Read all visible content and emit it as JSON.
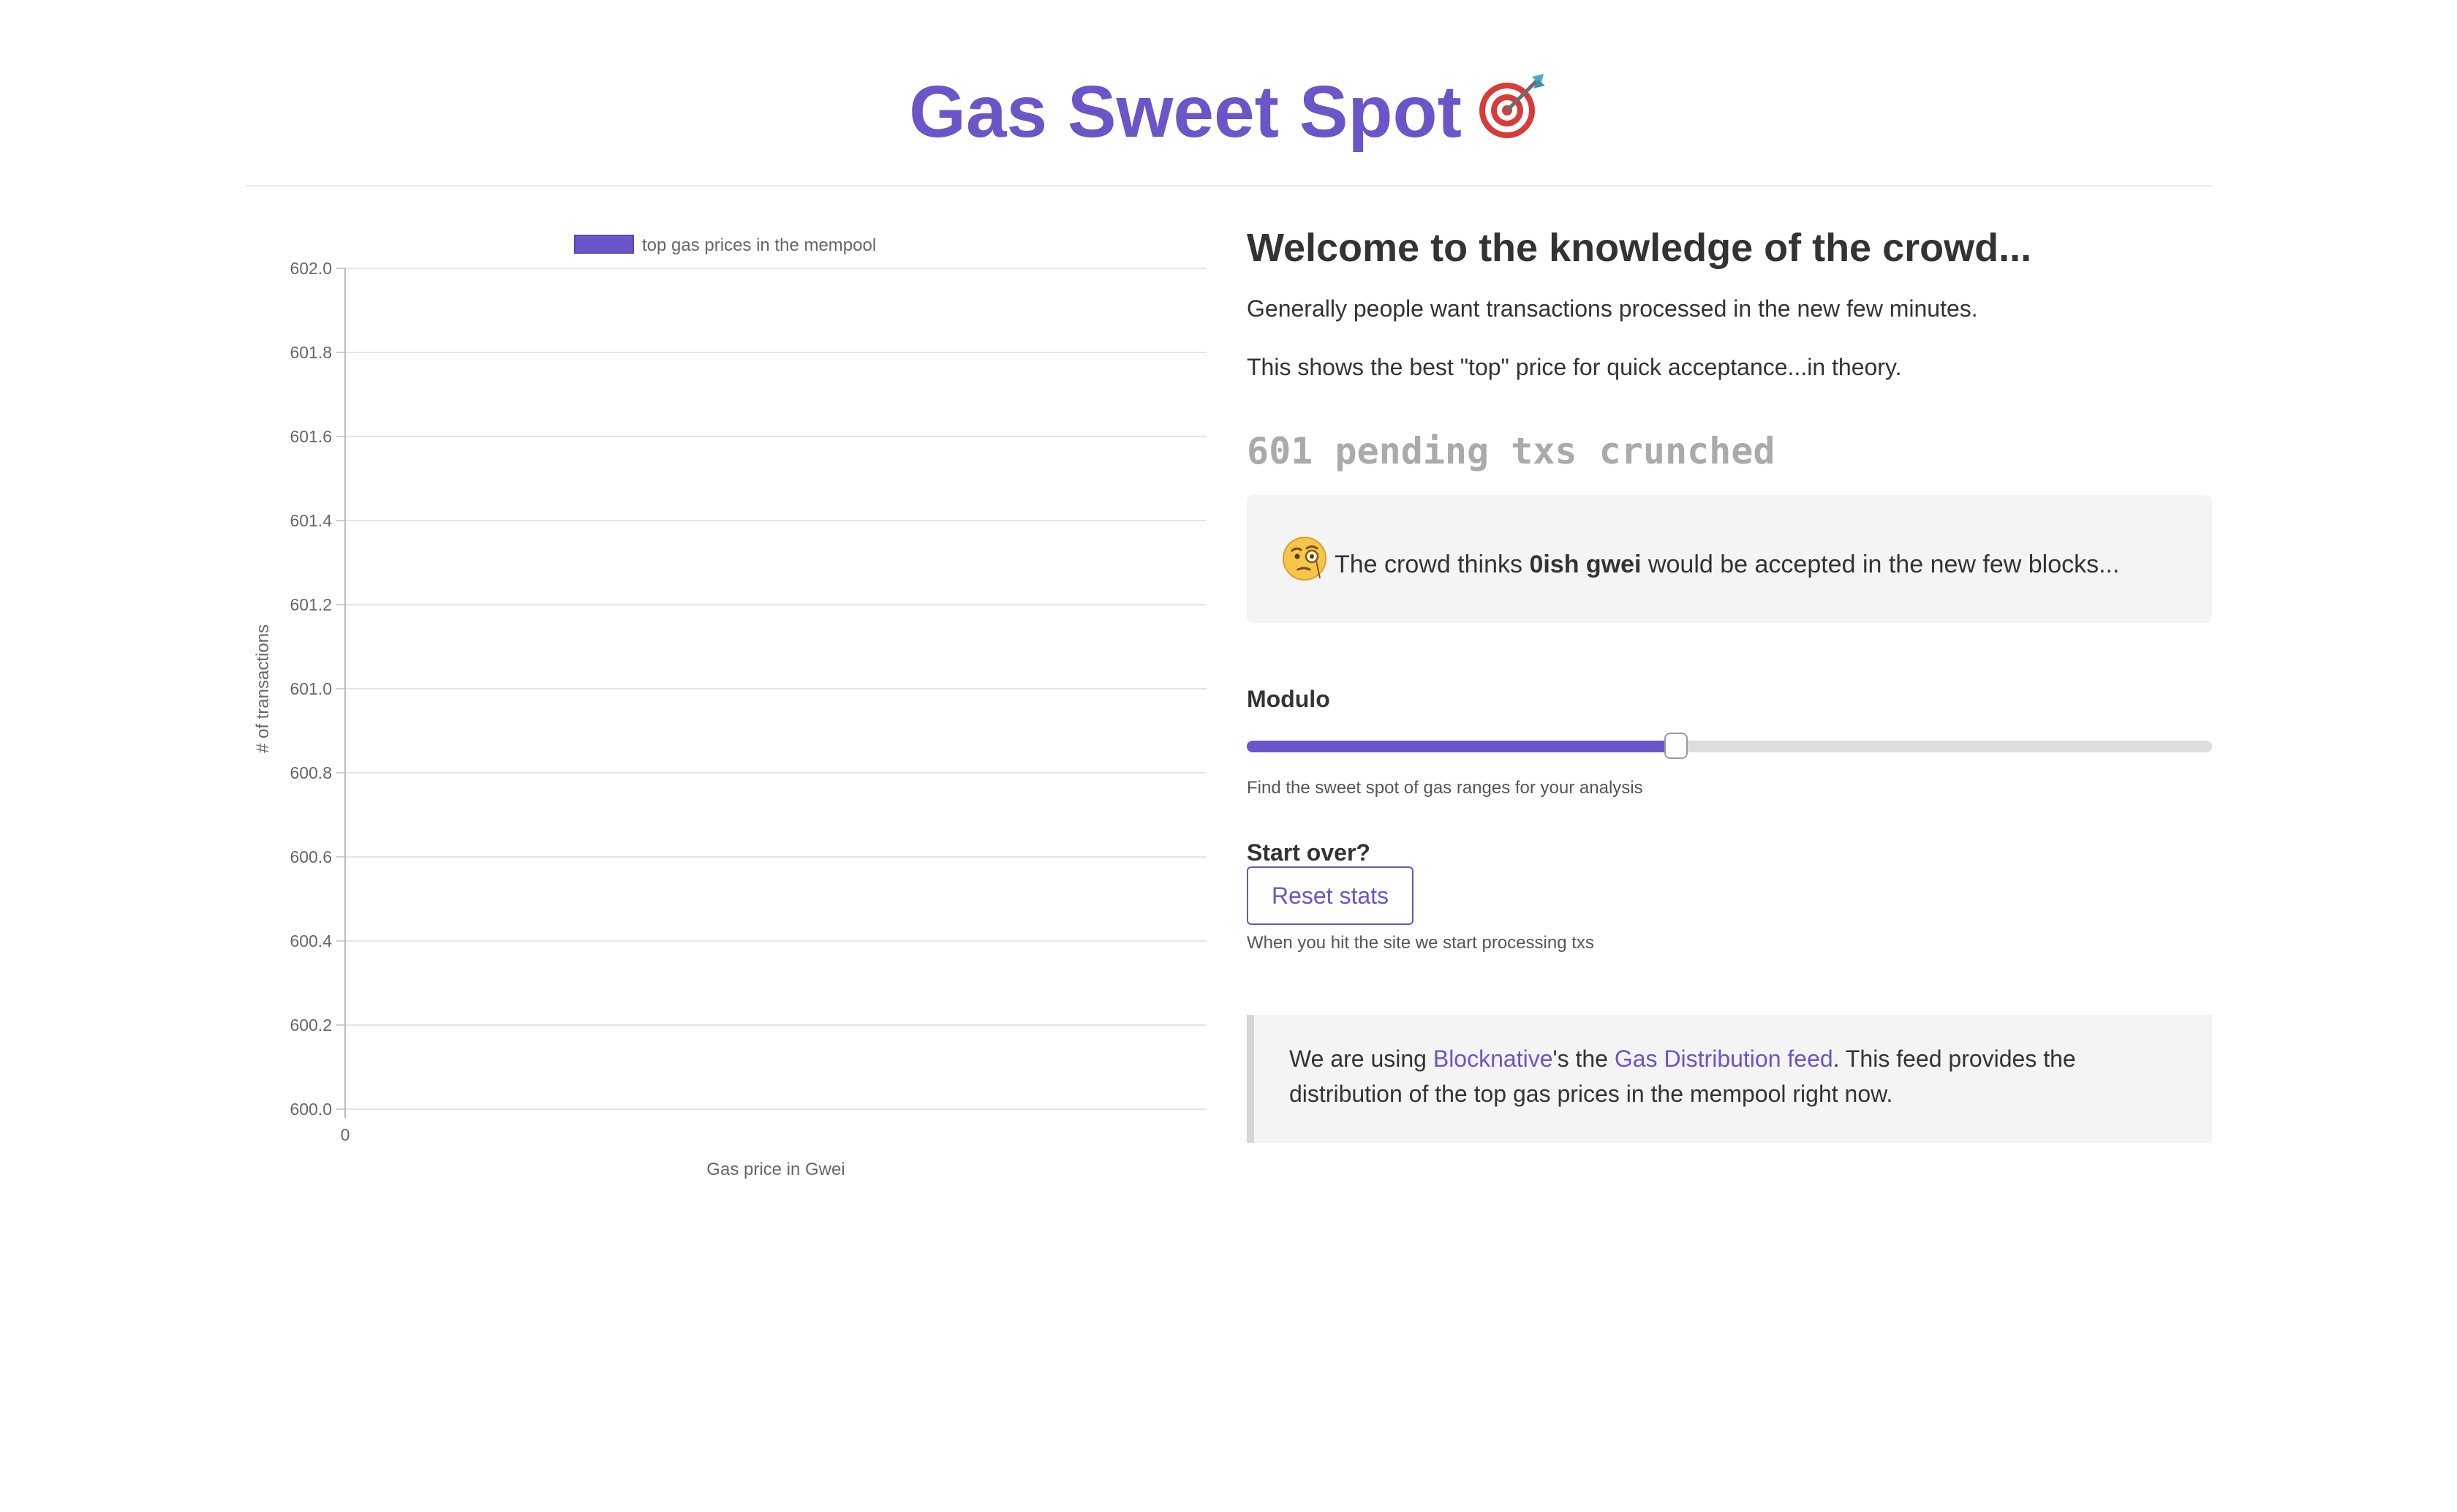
{
  "header": {
    "title": "Gas Sweet Spot",
    "title_icon": "dart-target-icon"
  },
  "chart_data": {
    "type": "bar",
    "title": "",
    "legend": [
      "top gas prices in the mempool"
    ],
    "legend_position": "top",
    "categories": [
      "0"
    ],
    "series": [
      {
        "name": "top gas prices in the mempool",
        "values": []
      }
    ],
    "xlabel": "Gas price in Gwei",
    "ylabel": "# of transactions",
    "ylim": [
      600.0,
      602.0
    ],
    "yticks": [
      "602.0",
      "601.8",
      "601.6",
      "601.4",
      "601.2",
      "601.0",
      "600.8",
      "600.6",
      "600.4",
      "600.2",
      "600.0"
    ],
    "grid": true,
    "color": "#6b55c8"
  },
  "main": {
    "heading": "Welcome to the knowledge of the crowd...",
    "para1": "Generally people want transactions processed in the new few minutes.",
    "para2": "This shows the best \"top\" price for quick acceptance...in theory.",
    "pending": "601 pending txs crunched",
    "crowd": {
      "icon": "face-with-monocle-icon",
      "prefix": "The crowd thinks ",
      "value": "0ish gwei",
      "suffix": " would be accepted in the new few blocks..."
    },
    "modulo_label": "Modulo",
    "modulo_value_percent": 44.5,
    "modulo_hint": "Find the sweet spot of gas ranges for your analysis",
    "startover_label": "Start over?",
    "reset_label": "Reset stats",
    "reset_hint": "When you hit the site we start processing txs",
    "note": {
      "prefix": "We are using ",
      "link1": "Blocknative",
      "middle": "'s the ",
      "link2": "Gas Distribution feed",
      "suffix": ". This feed provides the distribution of the top gas prices in the mempool right now."
    }
  },
  "colors": {
    "accent": "#6b55c8",
    "muted_text": "#aaaaaa",
    "panel_bg": "#f4f4f4"
  }
}
